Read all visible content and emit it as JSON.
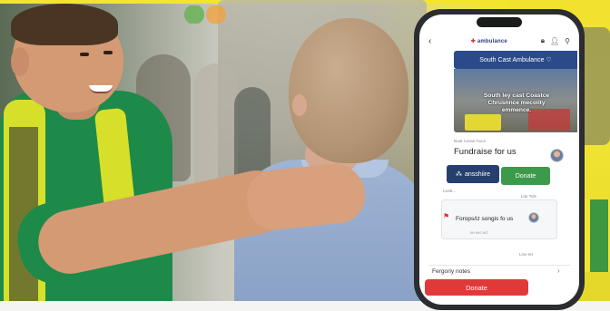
{
  "app": {
    "logo_text": "ambulance",
    "logo_mark": "✚",
    "back_icon": "arrow-left-icon",
    "header_icons": [
      "lock-icon",
      "user-icon",
      "person-icon"
    ]
  },
  "hero": {
    "title": "South Cast Ambulance ♡",
    "overlay_text": "South ley cast Coastce\n Chrusnnce mecoiity\nemmence.",
    "label": "Boat Caras Gucs"
  },
  "fundraise": {
    "heading": "Fundraise for us",
    "share_label": "ansshiire",
    "donate_label": "Donate",
    "caption_left": "Leatt...",
    "caption_right": "Lite Tols"
  },
  "card": {
    "text": "Forops/iz songis fo us",
    "sub": "ve exc ed",
    "footer_right": "Line ter"
  },
  "emergency_row": {
    "label": "Fergoriy notes"
  },
  "donate_button": {
    "label": "Donate"
  },
  "colors": {
    "primary_blue": "#25406f",
    "donate_green": "#3c9a4b",
    "donate_red": "#e0393a",
    "hero_blue": "#2a4a8a",
    "ambulance_yellow": "#f0e22e",
    "medic_green": "#1d8a4a"
  }
}
